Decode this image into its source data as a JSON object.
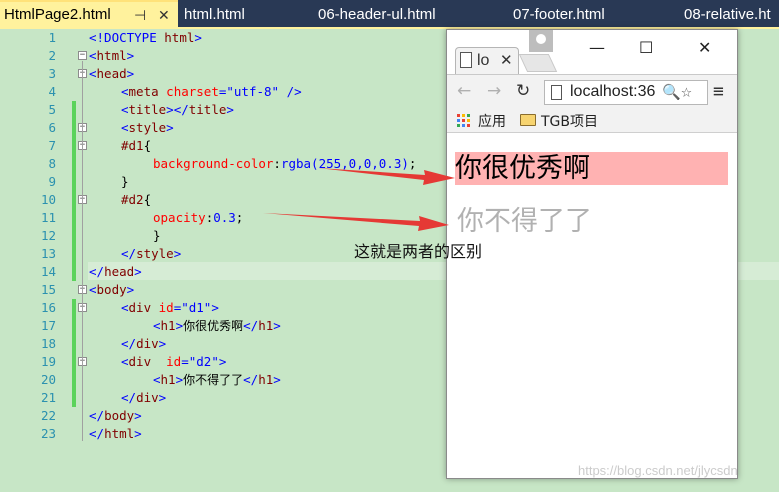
{
  "tabs": [
    {
      "label": "HtmlPage2.html",
      "active": true
    },
    {
      "label": "html.html"
    },
    {
      "label": "06-header-ul.html"
    },
    {
      "label": "07-footer.html"
    },
    {
      "label": "08-relative.ht"
    }
  ],
  "tab_pin_glyph": "⊣",
  "tab_close_glyph": "✕",
  "line_numbers": [
    "1",
    "2",
    "3",
    "4",
    "5",
    "6",
    "7",
    "8",
    "9",
    "10",
    "11",
    "12",
    "13",
    "14",
    "15",
    "16",
    "17",
    "18",
    "19",
    "20",
    "21",
    "22",
    "23"
  ],
  "code": {
    "l1": {
      "a": "<!DOCTYPE ",
      "b": "html",
      "c": ">"
    },
    "l2": {
      "a": "<",
      "b": "html",
      "c": ">"
    },
    "l3": {
      "a": "<",
      "b": "head",
      "c": ">"
    },
    "l4": {
      "a": "<",
      "b": "meta",
      "c": "charset",
      "d": "=\"utf-8\"",
      "e": " />"
    },
    "l5": {
      "a": "<",
      "b": "title",
      "c": "></",
      "d": "title",
      "e": ">"
    },
    "l6": {
      "a": "<",
      "b": "style",
      "c": ">"
    },
    "l7": {
      "a": "#d1",
      "b": "{"
    },
    "l8": {
      "a": "background-color",
      "b": ":",
      "c": "rgba(255,0,0,0.3)",
      "d": ";"
    },
    "l9": {
      "a": "}"
    },
    "l10": {
      "a": "#d2",
      "b": "{"
    },
    "l11": {
      "a": "opacity",
      "b": ":",
      "c": "0.3",
      "d": ";"
    },
    "l12": {
      "a": "}"
    },
    "l13": {
      "a": "</",
      "b": "style",
      "c": ">"
    },
    "l14": {
      "a": "</",
      "b": "head",
      "c": ">"
    },
    "l15": {
      "a": "<",
      "b": "body",
      "c": ">"
    },
    "l16": {
      "a": "<",
      "b": "div",
      "c": " id",
      "d": "=\"d1\"",
      "e": ">"
    },
    "l17": {
      "a": "<",
      "b": "h1",
      "c": ">",
      "d": "你很优秀啊",
      "e": "</",
      "f": "h1",
      "g": ">"
    },
    "l18": {
      "a": "</",
      "b": "div",
      "c": ">"
    },
    "l19": {
      "a": "<",
      "b": "div",
      "c": "  id",
      "d": "=\"d2\"",
      "e": ">"
    },
    "l20": {
      "a": "<",
      "b": "h1",
      "c": ">",
      "d": "你不得了了",
      "e": "</",
      "f": "h1",
      "g": ">"
    },
    "l21": {
      "a": "</",
      "b": "div",
      "c": ">"
    },
    "l22": {
      "a": "</",
      "b": "body",
      "c": ">"
    },
    "l23": {
      "a": "</",
      "b": "html",
      "c": ">"
    }
  },
  "browser": {
    "tab_label": "lo",
    "tab_close": "✕",
    "minimize": "—",
    "maximize": "☐",
    "close": "✕",
    "back": "←",
    "forward": "→",
    "reload": "↻",
    "url": "localhost:36",
    "zoom_glyph": "🔍",
    "star_glyph": "☆",
    "menu_glyph": "≡",
    "bookmarks": {
      "apps": "应用",
      "folder": "TGB项目"
    },
    "h1_d1": "你很优秀啊",
    "h1_d2": "你不得了了"
  },
  "annotation": "这就是两者的区别",
  "watermark": "https://blog.csdn.net/jlycsdn",
  "colors": {
    "tabbar": "#293955",
    "active_tab": "#fff29d",
    "editor_bg": "#c7e6c6",
    "arrow": "#e53935"
  }
}
